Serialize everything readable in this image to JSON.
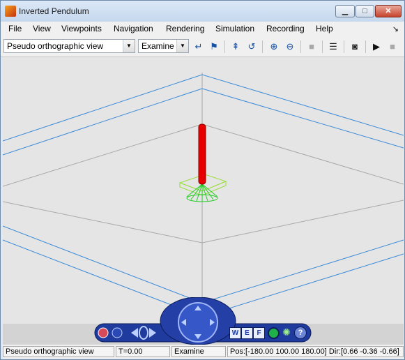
{
  "window": {
    "title": "Inverted Pendulum"
  },
  "menu": [
    "File",
    "View",
    "Viewpoints",
    "Navigation",
    "Rendering",
    "Simulation",
    "Recording",
    "Help"
  ],
  "toolbar": {
    "viewpoint_select": "Pseudo orthographic view",
    "navigation_select": "Examine"
  },
  "status": {
    "view": "Pseudo orthographic view",
    "time": "T=0.00",
    "mode": "Examine",
    "position": "Pos:[-180.00 100.00 180.00] Dir:[0.66 -0.36 -0.66]"
  },
  "navpanel": {
    "w_label": "W",
    "e_label": "E",
    "f_label": "F",
    "help_label": "?"
  },
  "colors": {
    "grid_blue": "#3b8ad8",
    "pendulum": "#e60000",
    "base": "#22cc22",
    "navpanel": "#1f3b9e"
  }
}
